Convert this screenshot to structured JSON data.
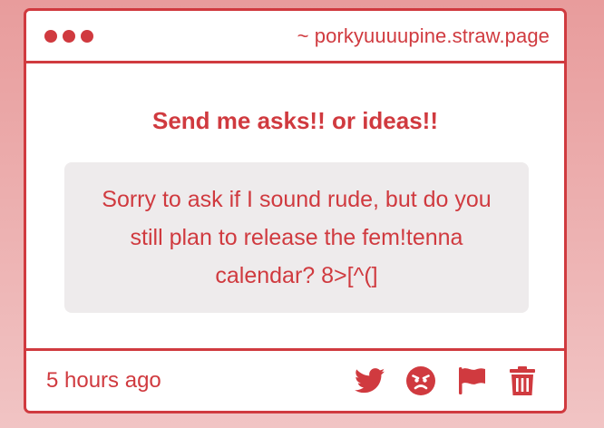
{
  "window": {
    "url": "~ porkyuuuupine.straw.page"
  },
  "prompt": {
    "title": "Send me asks!! or ideas!!"
  },
  "message": {
    "text": "Sorry to ask if I sound rude, but do you still plan to release the fem!tenna calendar? 8>[^(]"
  },
  "footer": {
    "timestamp": "5 hours ago",
    "actions": [
      "twitter-icon",
      "angry-face-icon",
      "flag-icon",
      "trash-icon"
    ]
  },
  "colors": {
    "accent": "#d03a3f",
    "message_bg": "#eeebec",
    "page_bg_top": "#e89c9c",
    "page_bg_bottom": "#f1c4c4"
  }
}
